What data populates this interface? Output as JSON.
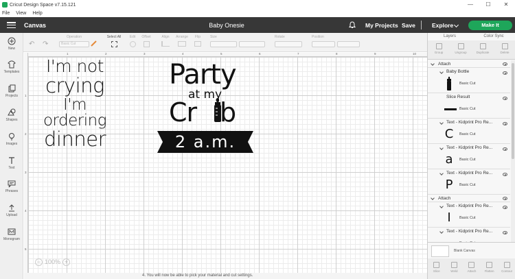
{
  "window": {
    "title": "Cricut Design Space  v7.15.121",
    "controls": [
      "—",
      "☐",
      "✕"
    ]
  },
  "menu": [
    "File",
    "View",
    "Help"
  ],
  "header": {
    "section": "Canvas",
    "project_name": "Baby Onesie",
    "my_projects": "My Projects",
    "save": "Save",
    "explore": "Explore",
    "make_it": "Make It"
  },
  "toolbar": {
    "operation_label": "Operation",
    "operation_value": "Basic Cut",
    "select_all": "Select All",
    "edit": "Edit",
    "offset": "Offset",
    "align": "Align",
    "arrange": "Arrange",
    "flip": "Flip",
    "size": "Size",
    "rotate": "Rotate",
    "position": "Position"
  },
  "sidebar": [
    {
      "label": "New",
      "icon": "plus-icon"
    },
    {
      "label": "Templates",
      "icon": "shirt-icon"
    },
    {
      "label": "Projects",
      "icon": "projects-icon"
    },
    {
      "label": "Shapes",
      "icon": "shapes-icon"
    },
    {
      "label": "Images",
      "icon": "lightbulb-icon"
    },
    {
      "label": "Text",
      "icon": "text-icon"
    },
    {
      "label": "Phrases",
      "icon": "speech-bubble-icon"
    },
    {
      "label": "Upload",
      "icon": "upload-icon"
    },
    {
      "label": "Monogram",
      "icon": "monogram-icon"
    }
  ],
  "ruler": {
    "top": [
      "1",
      "2",
      "3",
      "4",
      "5",
      "6",
      "7",
      "8",
      "9",
      "10"
    ],
    "left": [
      "1",
      "2",
      "3",
      "4",
      "5"
    ]
  },
  "canvas": {
    "quote_lines": [
      "I'm not",
      "crying",
      "I'm ordering",
      "dinner"
    ],
    "party_line1": "Party",
    "party_line2": "at my",
    "party_line3": "Cr",
    "party_line3b": "b",
    "banner_text": "2 a.m.",
    "zoom_minus": "−",
    "zoom_value": "100%",
    "zoom_plus": "+"
  },
  "bottom_strip": "4.   You will now be able to pick your material and cut settings.",
  "right_panel": {
    "tabs": [
      "Layers",
      "Color Sync"
    ],
    "actions": [
      "Group",
      "Ungroup",
      "Duplicate",
      "Delete"
    ],
    "groups": [
      {
        "label": "Attach"
      },
      {
        "label": "Attach"
      }
    ],
    "layers": [
      {
        "name": "Baby Bottle",
        "type": "Basic Cut",
        "thumb": "bottle"
      },
      {
        "name": "Slice Result",
        "type": "Basic Cut",
        "thumb": "bar"
      },
      {
        "name": "Text - Kidprint Pro Re...",
        "type": "Basic Cut",
        "thumb": "C"
      },
      {
        "name": "Text - Kidprint Pro Re...",
        "type": "Basic Cut",
        "thumb": "a"
      },
      {
        "name": "Text - Kidprint Pro Re...",
        "type": "Basic Cut",
        "thumb": "P"
      },
      {
        "name": "Text - Kidprint Pro Re...",
        "type": "Basic Cut",
        "thumb": "I"
      },
      {
        "name": "Text - Kidprint Pro Re...",
        "type": "Basic Cut",
        "thumb": ""
      }
    ],
    "blank_canvas": "Blank Canvas",
    "bottom_actions": [
      "Slice",
      "Weld",
      "Attach",
      "Flatten",
      "Contour"
    ]
  },
  "colors": {
    "header_bg": "#373737",
    "make_it": "#1ea65a",
    "banner": "#111111"
  }
}
